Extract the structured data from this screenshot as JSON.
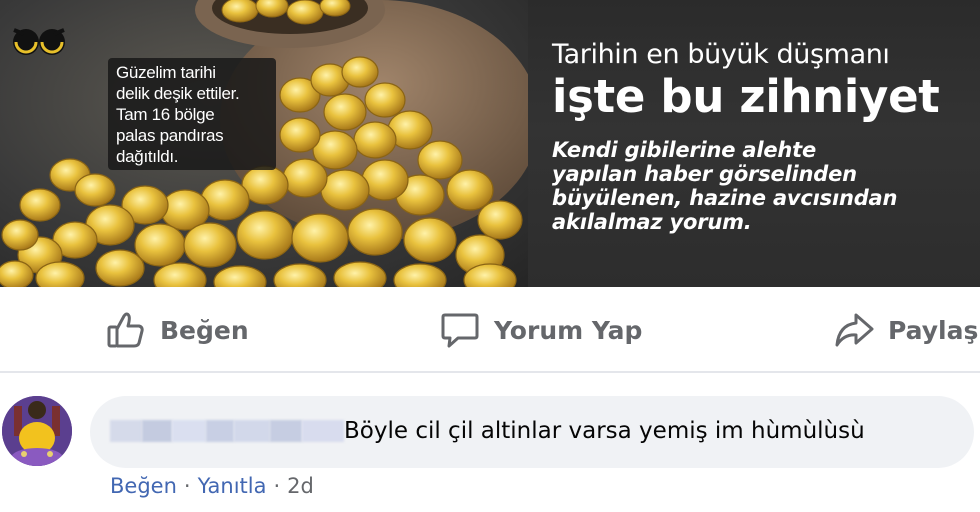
{
  "banner": {
    "caption_lines": [
      "Güzelim tarihi",
      "delik deşik ettiler.",
      "Tam 16 bölge",
      "palas pandıras",
      "dağıtıldı."
    ],
    "headline_line1": "Tarihin en büyük düşmanı",
    "headline_line2": "işte bu zihniyet",
    "subhead_lines": [
      "Kendi gibilerine alehte",
      "yapılan haber görselinden",
      "büyülenen, hazine avcısından",
      "akılalmaz yorum."
    ]
  },
  "actions": {
    "like_label": "Beğen",
    "comment_label": "Yorum Yap",
    "share_label": "Paylaş"
  },
  "comment": {
    "text": "Böyle cil çil altinlar varsa yemiş im hùmùlùsù",
    "like_label": "Beğen",
    "separator": "·",
    "reply_label": "Yanıtla",
    "time": "2d"
  },
  "colors": {
    "link_blue": "#4267b2",
    "icon_gray": "#65676b",
    "bubble_bg": "#f0f2f5",
    "gold": "#e2b532",
    "panel_dark": "#2f2f2f"
  },
  "icons": [
    "site-logo-icon",
    "thumbs-up-icon",
    "comment-icon",
    "share-arrow-icon"
  ]
}
